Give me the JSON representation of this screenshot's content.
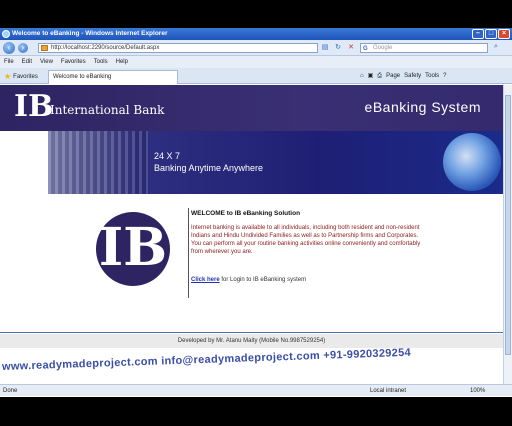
{
  "window": {
    "title": "Welcome to eBanking - Windows Internet Explorer"
  },
  "address_bar": {
    "url": "http://localhost:2290/source/Default.aspx",
    "search_placeholder": "Google"
  },
  "menu": [
    "File",
    "Edit",
    "View",
    "Favorites",
    "Tools",
    "Help"
  ],
  "tabs": {
    "favorites_label": "Favorites",
    "active_tab": "Welcome to eBanking",
    "page_label": "Page",
    "safety_label": "Safety",
    "tools_label": "Tools"
  },
  "banner": {
    "logo_mark": "IB",
    "bank_name": "International Bank",
    "system_name": "eBanking System"
  },
  "hero": {
    "line1": "24 X 7",
    "line2": "Banking Anytime Anywhere"
  },
  "content": {
    "welcome_title": "WELCOME to IB eBanking Solution",
    "paragraph": "Internet banking is available to all individuals, including both resident and non-resident Indians and Hindu Undivided Families as well as to Partnership firms and Corporates. You can perform all your routine banking activities online conveniently and comfortably from wherever you are.",
    "login_link": "Click here",
    "login_suffix": " for Login to IB eBanking system"
  },
  "footer": {
    "text": "Developed by Mr. Atanu Maity (Mobile No.9987529254)"
  },
  "watermark": {
    "text": "www.readymadeproject.com  info@readymadeproject.com  +91-9920329254"
  },
  "status": {
    "left": "Done",
    "zone": "Local intranet",
    "zoom": "100%"
  },
  "colors": {
    "brand_purple": "#2e2462",
    "link_blue": "#2233aa",
    "paragraph_red": "#8b1a1a"
  }
}
